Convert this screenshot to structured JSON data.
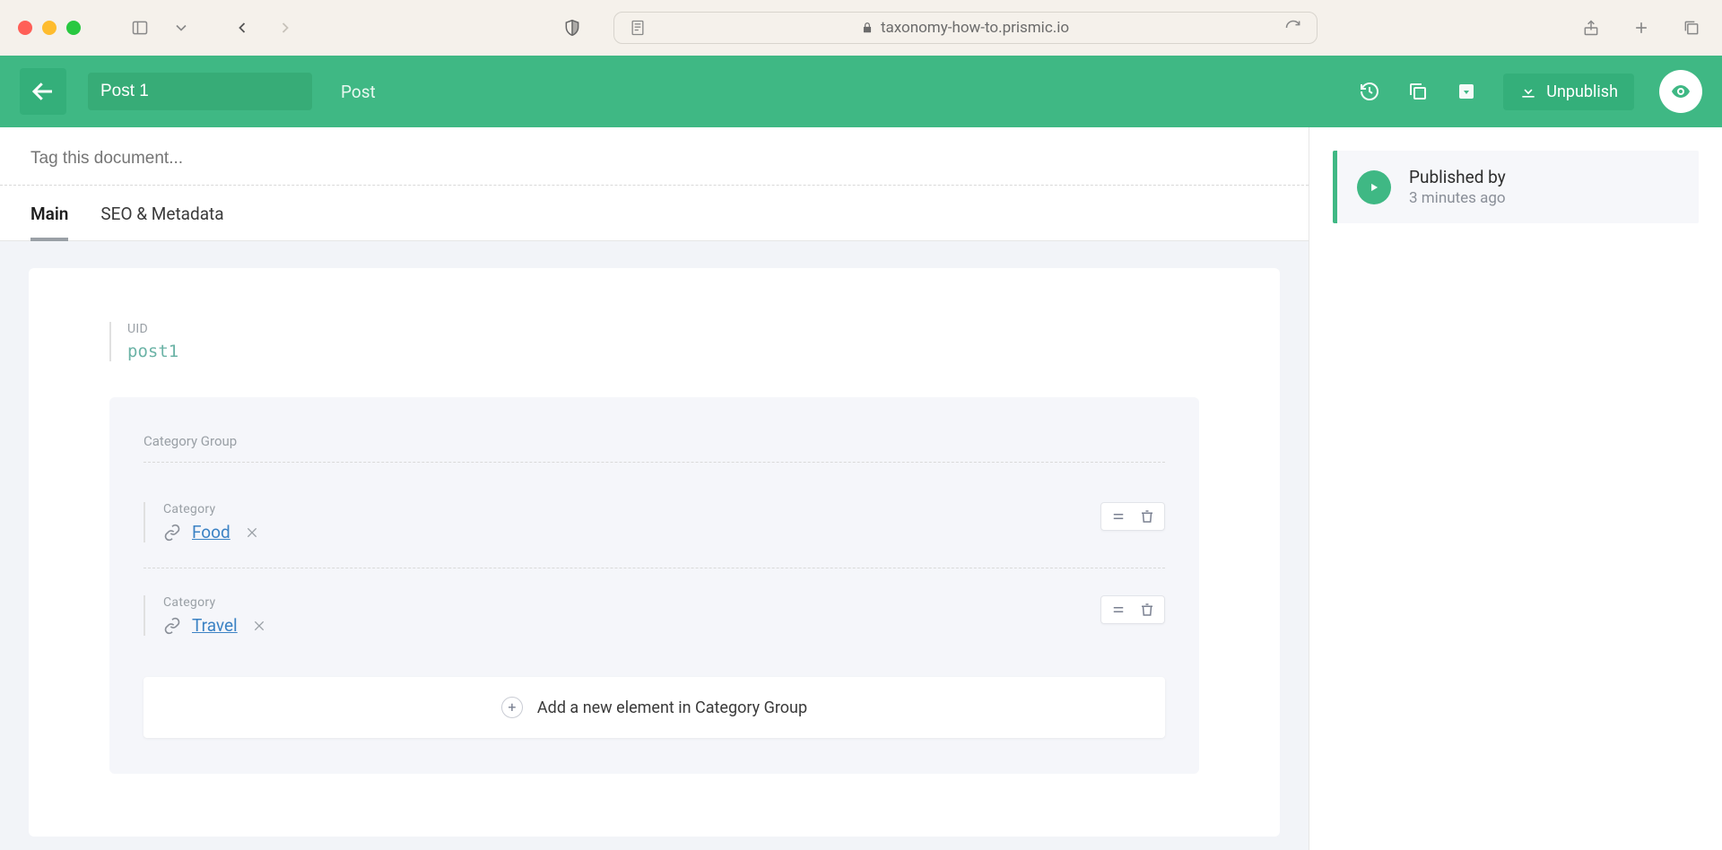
{
  "browser": {
    "url": "taxonomy-how-to.prismic.io"
  },
  "header": {
    "title_value": "Post 1",
    "type_label": "Post",
    "unpublish_label": "Unpublish"
  },
  "editor": {
    "tag_placeholder": "Tag this document...",
    "tabs": [
      {
        "label": "Main",
        "active": true
      },
      {
        "label": "SEO & Metadata",
        "active": false
      }
    ],
    "uid": {
      "label": "UID",
      "value": "post1"
    },
    "category_group": {
      "label": "Category Group",
      "item_label": "Category",
      "items": [
        {
          "value": "Food"
        },
        {
          "value": "Travel"
        }
      ],
      "add_label": "Add a new element in Category Group"
    }
  },
  "sidebar": {
    "published_by": "Published by",
    "timestamp": "3 minutes ago"
  }
}
